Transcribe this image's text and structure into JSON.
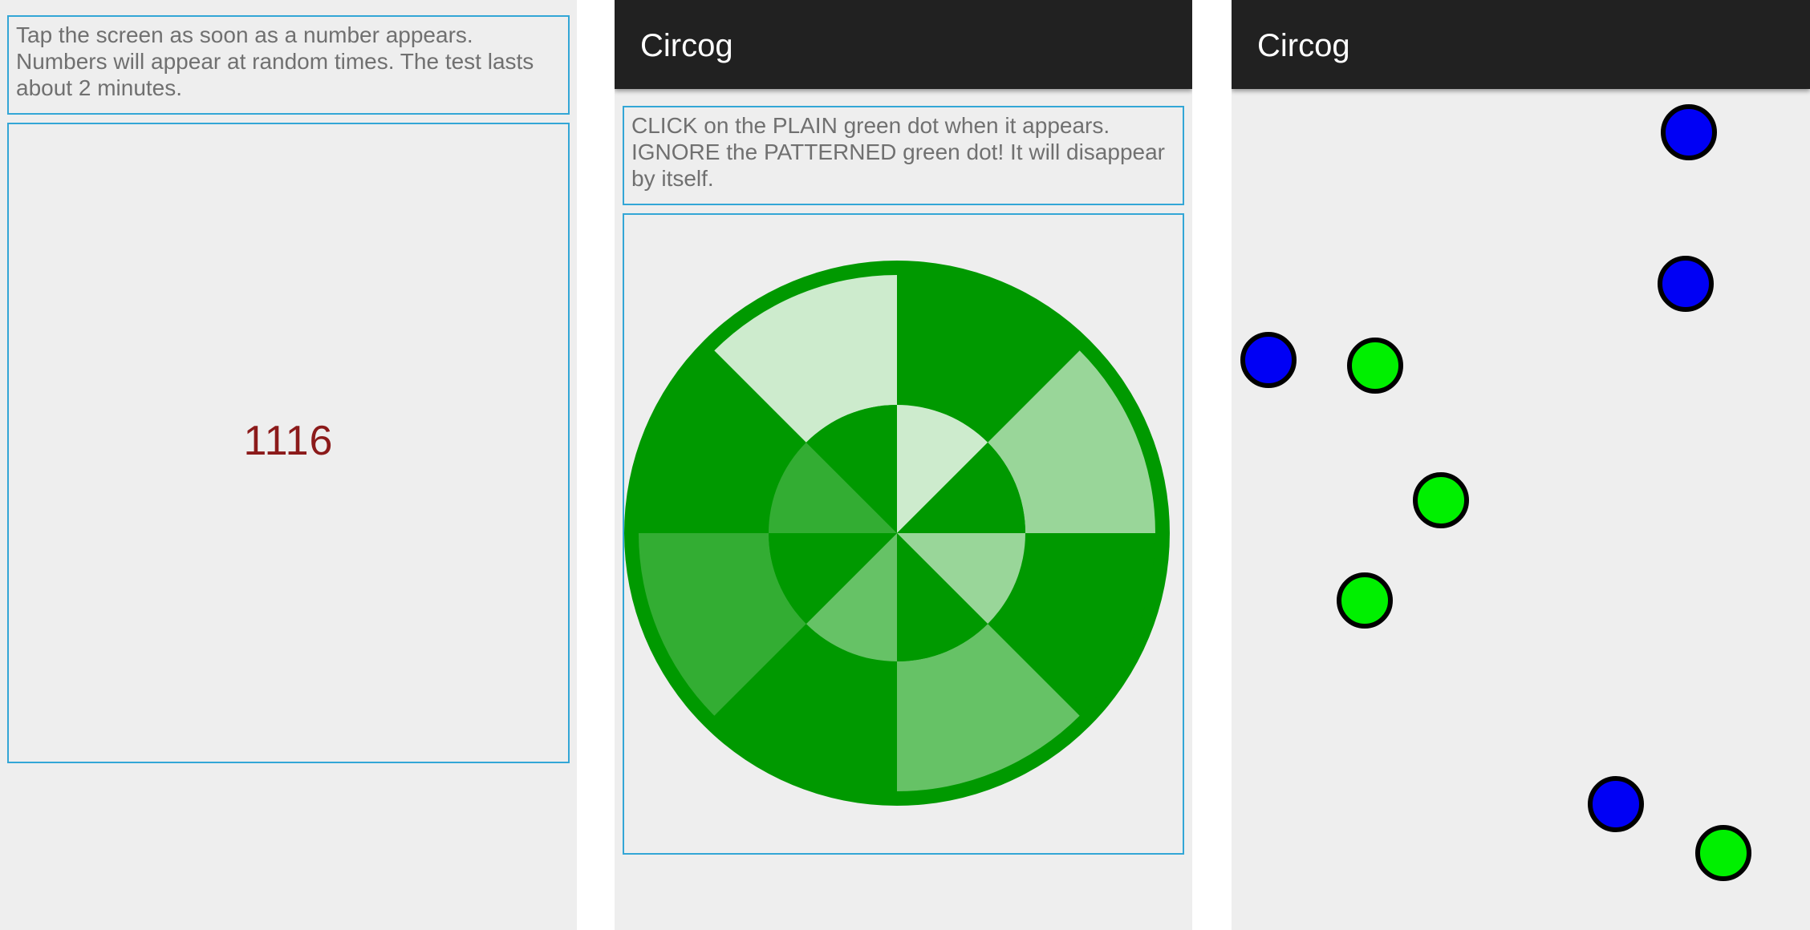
{
  "screens": [
    {
      "instructions": "Tap the screen as soon as a number appears. Numbers will appear at random times. The test lasts about 2 minutes.",
      "number": "1116"
    },
    {
      "app_title": "Circog",
      "instructions": "CLICK on the PLAIN green dot when it appears. IGNORE the PATTERNED green dot! It will disappear by itself."
    },
    {
      "app_title": "Circog",
      "dots": [
        {
          "color": "blue"
        },
        {
          "color": "blue"
        },
        {
          "color": "blue"
        },
        {
          "color": "green"
        },
        {
          "color": "green"
        },
        {
          "color": "green"
        },
        {
          "color": "blue"
        },
        {
          "color": "green"
        }
      ]
    }
  ],
  "colors": {
    "dot_blue": "#0000f5",
    "dot_green": "#00f000",
    "stimulus_green": "#009900",
    "number_red": "#8b1a1a",
    "border_blue": "#33a6d6",
    "action_bar": "#212121"
  }
}
